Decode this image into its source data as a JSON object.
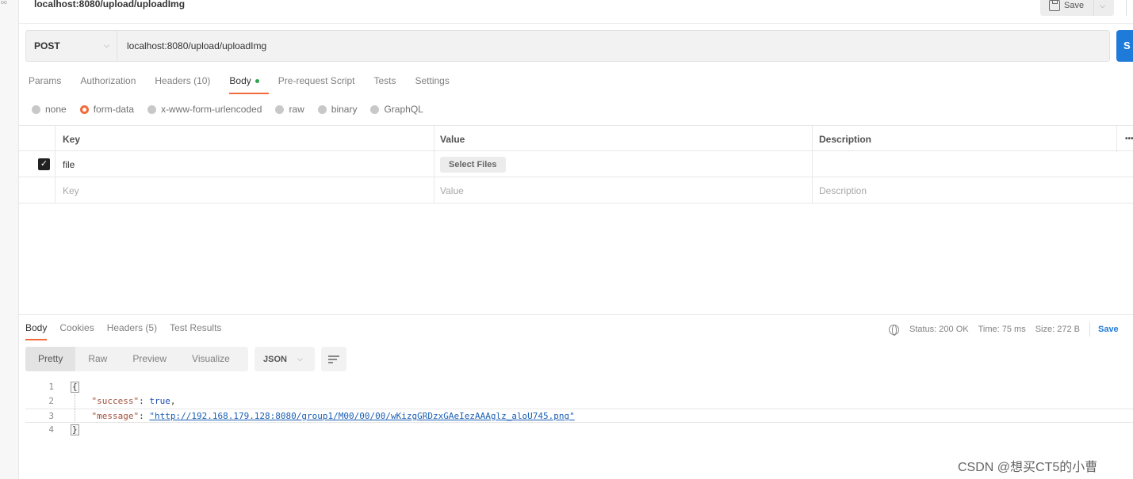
{
  "left_rail": {
    "tiny_text": "oo"
  },
  "title_bar": {
    "request_name": "localhost:8080/upload/uploadImg",
    "save_label": "Save"
  },
  "request": {
    "method": "POST",
    "url": "localhost:8080/upload/uploadImg",
    "send_label": "S"
  },
  "request_tabs": [
    "Params",
    "Authorization",
    "Headers (10)",
    "Body",
    "Pre-request Script",
    "Tests",
    "Settings"
  ],
  "body_types": [
    "none",
    "form-data",
    "x-www-form-urlencoded",
    "raw",
    "binary",
    "GraphQL"
  ],
  "table": {
    "headers": {
      "key": "Key",
      "value": "Value",
      "description": "Description",
      "more": "•••"
    },
    "row": {
      "key": "file",
      "value_button": "Select Files"
    },
    "empty_row": {
      "key": "Key",
      "value": "Value",
      "description": "Description"
    }
  },
  "response_tabs": [
    "Body",
    "Cookies",
    "Headers (5)",
    "Test Results"
  ],
  "response_status": {
    "status": "Status: 200 OK",
    "time": "Time: 75 ms",
    "size": "Size: 272 B",
    "save": "Save"
  },
  "view_tabs": [
    "Pretty",
    "Raw",
    "Preview",
    "Visualize"
  ],
  "format": "JSON",
  "code": {
    "line_numbers": [
      "1",
      "2",
      "3",
      "4"
    ],
    "open_brace": "{",
    "close_brace": "}",
    "success_key": "\"success\"",
    "success_value": "true",
    "message_key": "\"message\"",
    "message_value": "\"http://192.168.179.128:8080/group1/M00/00/00/wKizgGRDzxGAeIezAAAglz_aloU745.png\""
  },
  "watermark": "CSDN @想买CT5的小曹"
}
